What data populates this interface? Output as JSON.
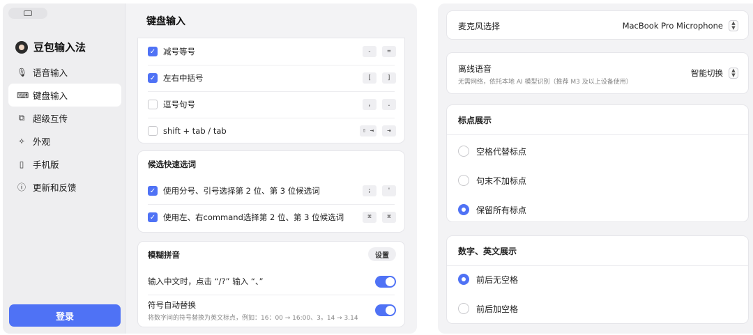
{
  "sidebar": {
    "app_title": "豆包输入法",
    "items": [
      {
        "label": "语音输入",
        "icon": "microphone-icon",
        "glyph": "🎙"
      },
      {
        "label": "键盘输入",
        "icon": "keyboard-icon",
        "glyph": "⌨"
      },
      {
        "label": "超级互传",
        "icon": "devices-icon",
        "glyph": "⧉"
      },
      {
        "label": "外观",
        "icon": "appearance-icon",
        "glyph": "✧"
      },
      {
        "label": "手机版",
        "icon": "phone-icon",
        "glyph": "▯"
      },
      {
        "label": "更新和反馈",
        "icon": "info-icon",
        "glyph": "ⓘ"
      }
    ],
    "active_index": 1,
    "login_label": "登录"
  },
  "keyboard": {
    "section_title": "键盘输入",
    "pair_rows": [
      {
        "label": "减号等号",
        "checked": true,
        "keys": [
          "-",
          "="
        ]
      },
      {
        "label": "左右中括号",
        "checked": true,
        "keys": [
          "[",
          "]"
        ]
      },
      {
        "label": "逗号句号",
        "checked": false,
        "keys": [
          ",",
          "."
        ]
      },
      {
        "label": "shift + tab / tab",
        "checked": false,
        "keys": [
          "⇧ ⇥",
          "⇥"
        ]
      }
    ],
    "candidate": {
      "title": "候选快速选词",
      "rows": [
        {
          "label": "使用分号、引号选择第 2 位、第 3 位候选词",
          "checked": true,
          "keys": [
            ";",
            "'"
          ]
        },
        {
          "label": "使用左、右command选择第 2 位、第 3 位候选词",
          "checked": true,
          "keys": [
            "⌘",
            "⌘"
          ]
        }
      ]
    },
    "fuzzy": {
      "title": "模糊拼音",
      "settings_label": "设置",
      "row1_label": "输入中文时，点击 “/?” 输入 “、”",
      "row1_on": true,
      "row2_label": "符号自动替换",
      "row2_sub": "将数字间的符号替换为英文标点，例如：16：00 → 16:00、3。14 → 3.14",
      "row2_on": true
    }
  },
  "voice": {
    "mic_label": "麦克风选择",
    "mic_value": "MacBook Pro Microphone",
    "offline_label": "离线语音",
    "offline_sub": "无需网络，依托本地 AI 模型识别（推荐 M3 及以上设备使用）",
    "offline_value": "智能切换",
    "punct_title": "标点展示",
    "punct_options": [
      {
        "label": "空格代替标点",
        "selected": false
      },
      {
        "label": "句末不加标点",
        "selected": false
      },
      {
        "label": "保留所有标点",
        "selected": true
      }
    ],
    "num_title": "数字、英文展示",
    "num_options": [
      {
        "label": "前后无空格",
        "selected": true
      },
      {
        "label": "前后加空格",
        "selected": false
      }
    ]
  },
  "colors": {
    "accent": "#4f72f5"
  }
}
